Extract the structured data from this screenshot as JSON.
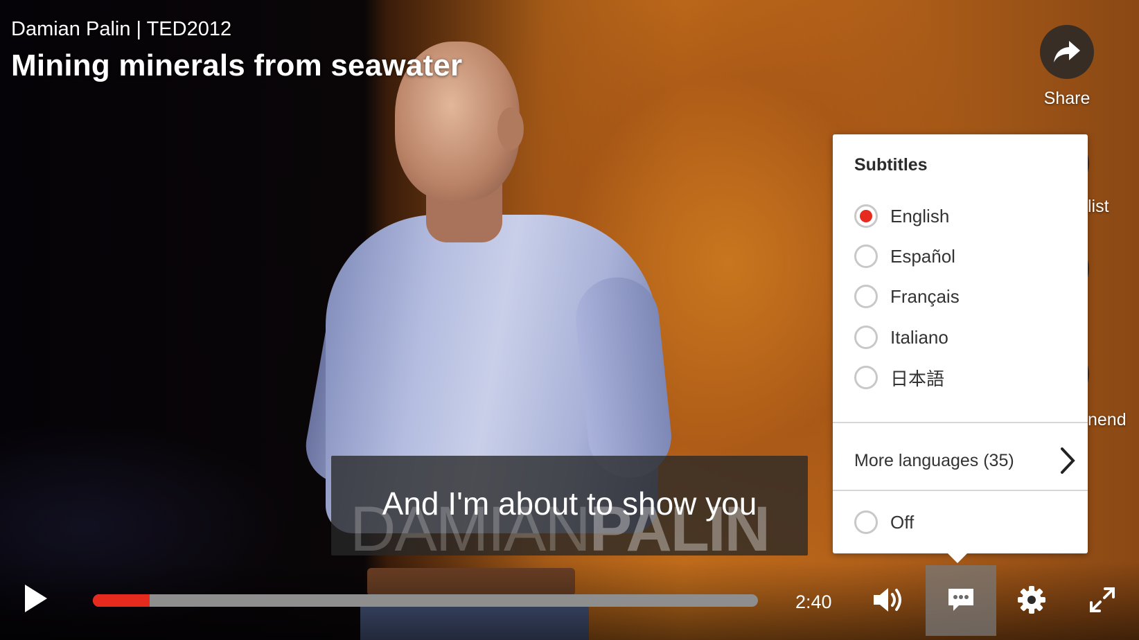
{
  "header": {
    "speaker_event": "Damian Palin | TED2012",
    "talk_title": "Mining minerals from seawater"
  },
  "rail": {
    "share_label": "Share",
    "partial_label_1": "list",
    "partial_label_2": "nend"
  },
  "subtitles_menu": {
    "heading": "Subtitles",
    "options": [
      {
        "label": "English",
        "selected": true
      },
      {
        "label": "Español",
        "selected": false
      },
      {
        "label": "Français",
        "selected": false
      },
      {
        "label": "Italiano",
        "selected": false
      },
      {
        "label": "日本語",
        "selected": false
      }
    ],
    "more_languages": "More languages (35)",
    "off_label": "Off"
  },
  "video": {
    "caption": "And I'm about to show you",
    "lower_third_first": "DAMIAN",
    "lower_third_last": "PALIN"
  },
  "controls": {
    "time": "2:40",
    "progress_fraction": 0.085
  },
  "colors": {
    "accent": "#e62b1e"
  },
  "icons": [
    "share-icon",
    "play-icon",
    "volume-icon",
    "subtitles-icon",
    "settings-icon",
    "fullscreen-icon",
    "chevron-right-icon"
  ]
}
